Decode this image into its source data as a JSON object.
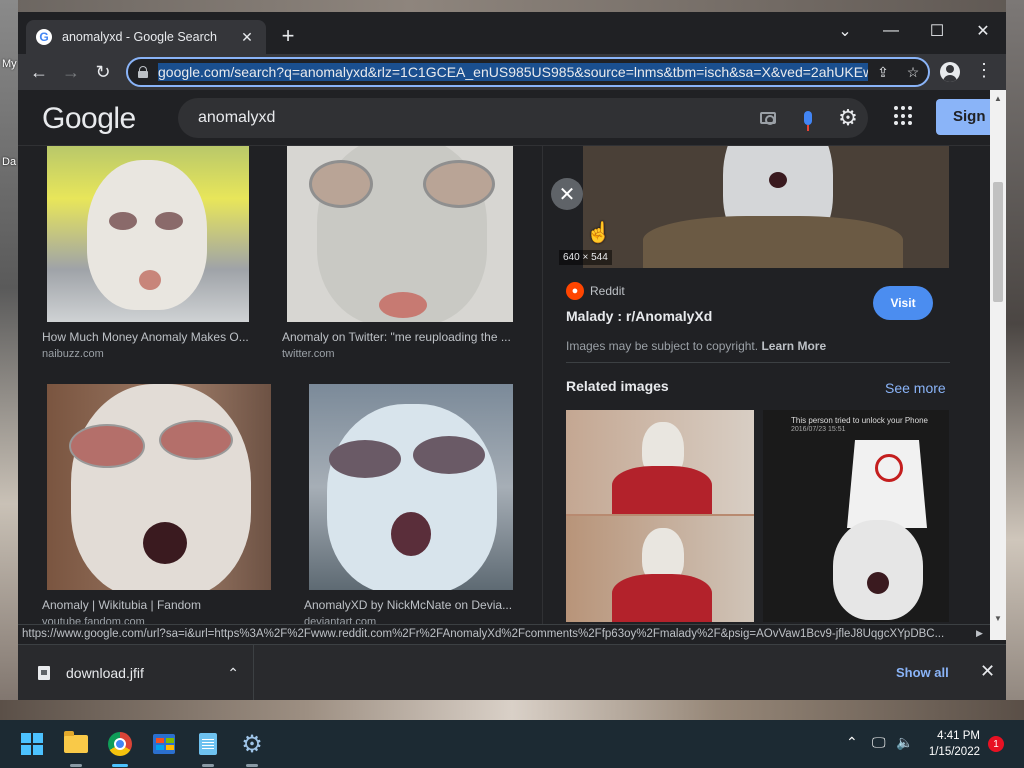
{
  "desktop": {
    "label_1": "My",
    "label_2": "Da"
  },
  "browser": {
    "tab_title": "anomalyxd - Google Search",
    "favicon": "G",
    "url": "google.com/search?q=anomalyxd&rlz=1C1GCEA_enUS985US985&source=lnms&tbm=isch&sa=X&ved=2ahUKEw",
    "status_url": "https://www.google.com/url?sa=i&url=https%3A%2F%2Fwww.reddit.com%2Fr%2FAnomalyXd%2Fcomments%2Ffp63oy%2Fmalady%2F&psig=AOvVaw1Bcv9-jfleJ8UqgcXYpDBC..."
  },
  "google": {
    "logo": "Google",
    "query": "anomalyxd",
    "sign_in": "Sign in"
  },
  "results": [
    {
      "title": "How Much Money Anomaly Makes O...",
      "source": "naibuzz.com"
    },
    {
      "title": "Anomaly on Twitter: \"me reuploading the ...",
      "source": "twitter.com"
    },
    {
      "title": "Anomaly | Wikitubia | Fandom",
      "source": "youtube.fandom.com"
    },
    {
      "title": "AnomalyXD by NickMcNate on Devia...",
      "source": "deviantart.com"
    }
  ],
  "panel": {
    "dimensions": "640 × 544",
    "source_name": "Reddit",
    "title": "Malady : r/AnomalyXd",
    "visit": "Visit",
    "copyright": "Images may be subject to copyright.",
    "learn_more": "Learn More",
    "related_heading": "Related images",
    "see_more": "See more",
    "related_caption": "This person tried to unlock your Phone",
    "related_date": "2016/07/23 15:51"
  },
  "downloads": {
    "file": "download.jfif",
    "show_all": "Show all"
  },
  "taskbar": {
    "time": "4:41 PM",
    "date": "1/15/2022",
    "notifications": "1"
  }
}
